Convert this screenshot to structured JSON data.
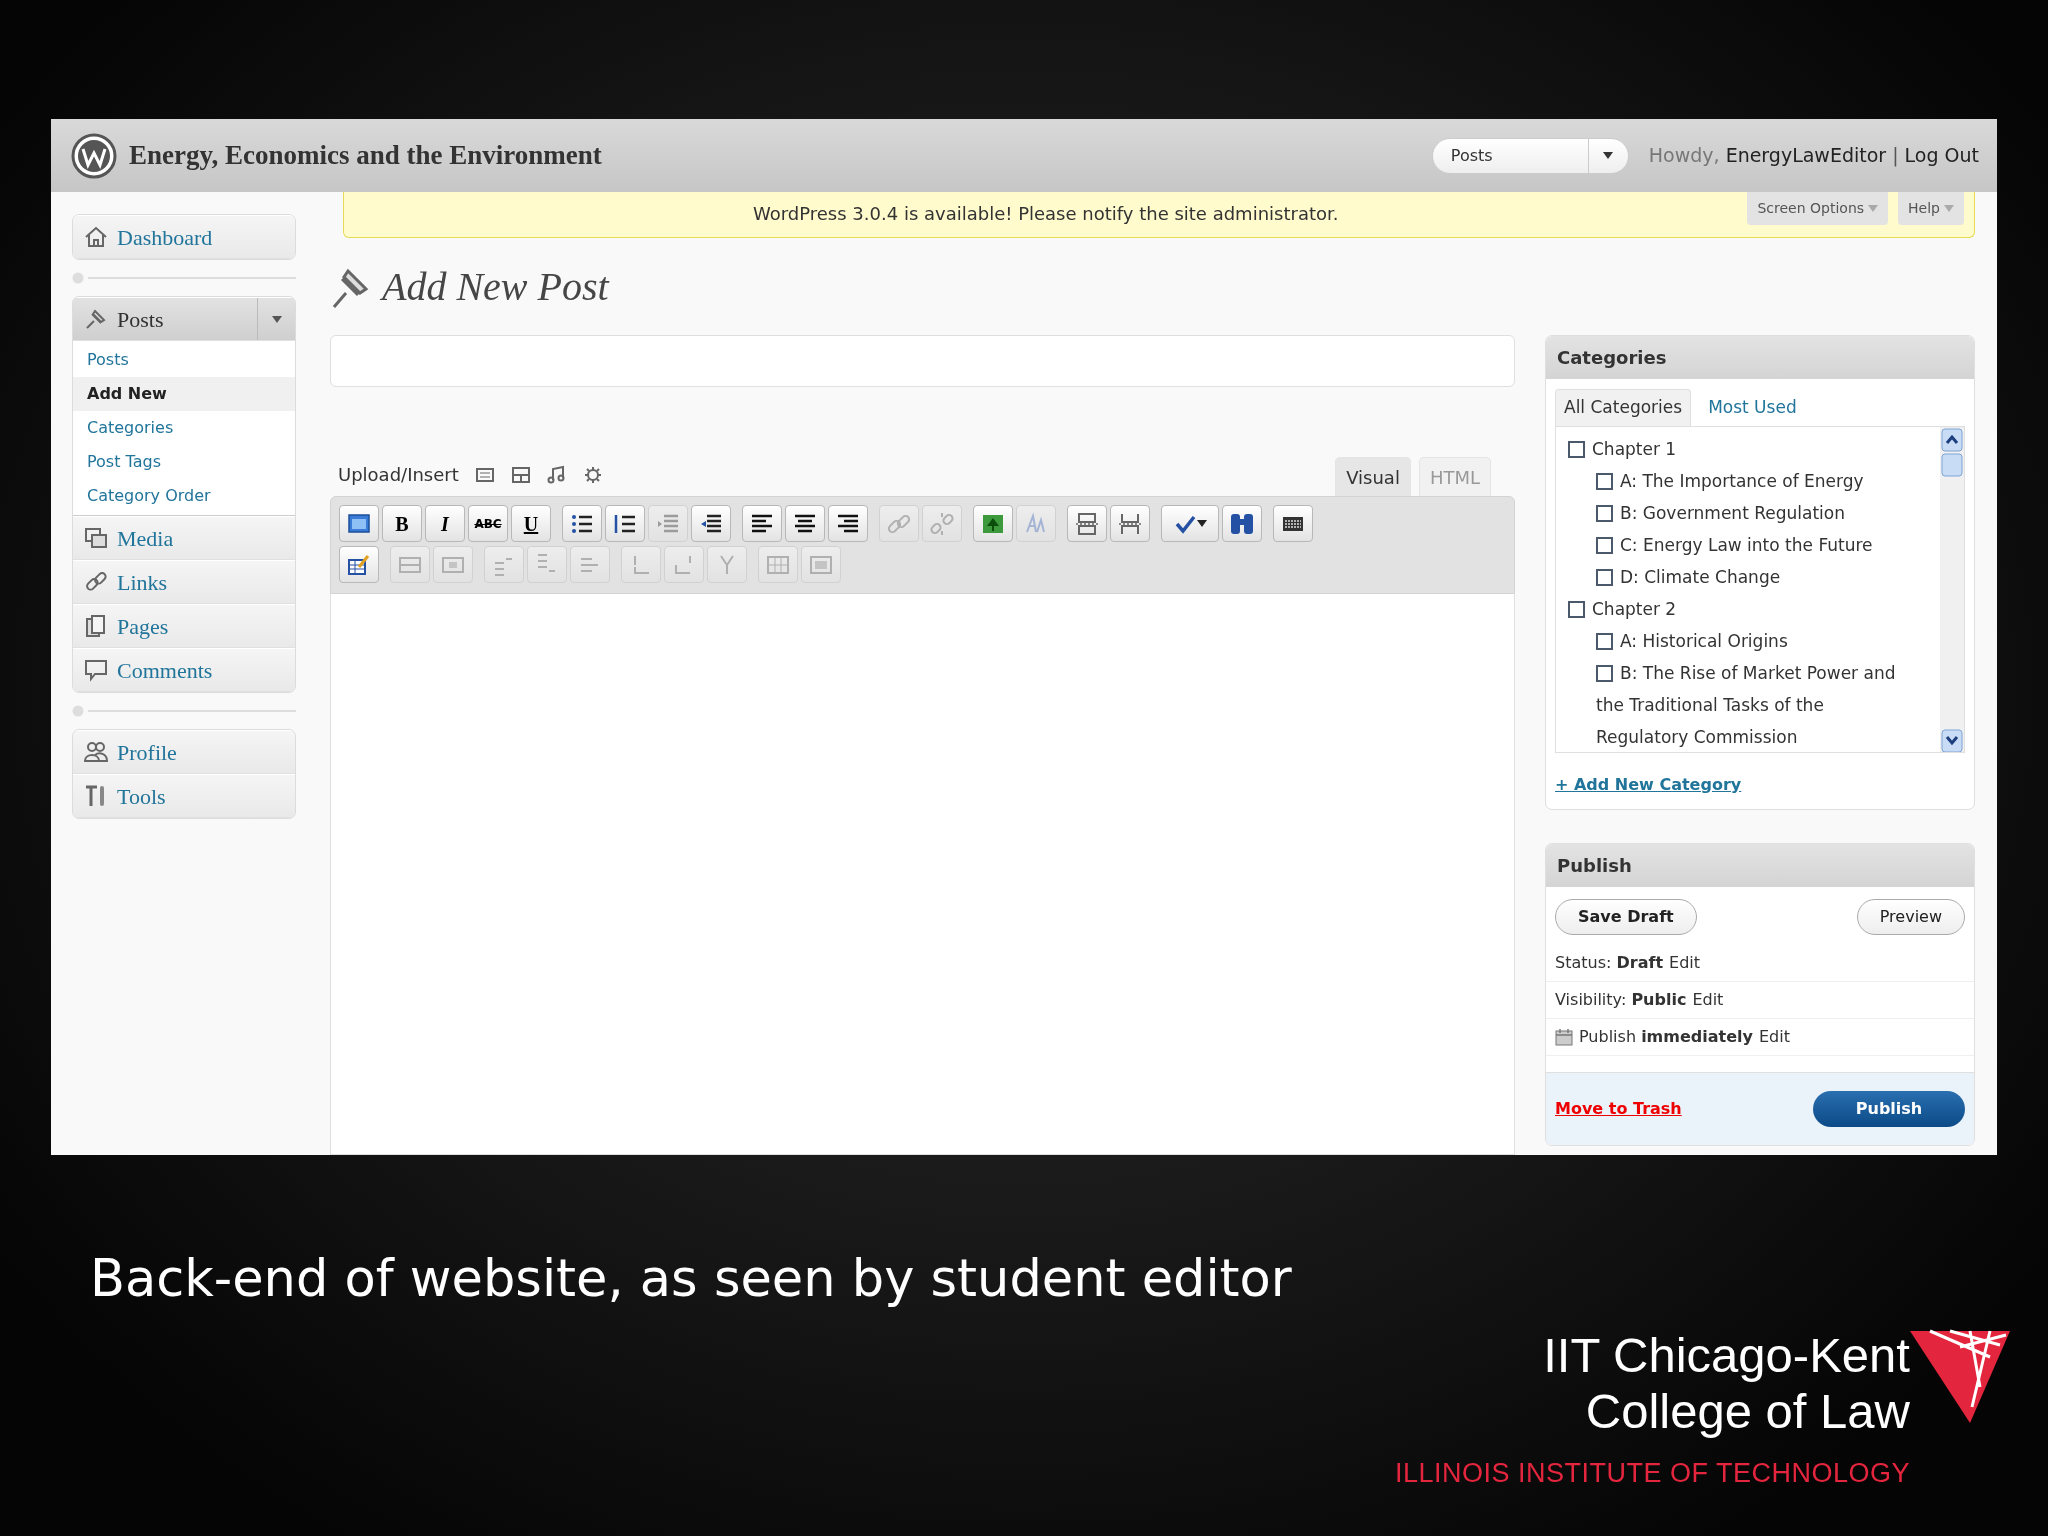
{
  "header": {
    "site_title": "Energy, Economics and the Environment",
    "favorites": "Posts",
    "greeting": "Howdy,",
    "user": "EnergyLawEditor",
    "separator": "|",
    "logout": "Log Out"
  },
  "notice": {
    "link": "WordPress 3.0.4",
    "text": "is available! Please notify the site administrator."
  },
  "screen_tabs": [
    {
      "label": "Screen Options"
    },
    {
      "label": "Help"
    }
  ],
  "sidebar": {
    "groups": [
      {
        "items": [
          {
            "label": "Dashboard",
            "kind": "house",
            "expanded": false
          }
        ]
      },
      {
        "items": [
          {
            "label": "Posts",
            "kind": "pin",
            "expanded": true,
            "children": [
              {
                "label": "Posts",
                "selected": false
              },
              {
                "label": "Add New",
                "selected": true
              },
              {
                "label": "Categories",
                "selected": false
              },
              {
                "label": "Post Tags",
                "selected": false
              },
              {
                "label": "Category Order",
                "selected": false
              }
            ]
          },
          {
            "label": "Media",
            "kind": "media",
            "expanded": false
          },
          {
            "label": "Links",
            "kind": "link",
            "expanded": false
          },
          {
            "label": "Pages",
            "kind": "pages",
            "expanded": false
          },
          {
            "label": "Comments",
            "kind": "comments",
            "expanded": false
          }
        ]
      },
      {
        "items": [
          {
            "label": "Profile",
            "kind": "profile",
            "expanded": false
          },
          {
            "label": "Tools",
            "kind": "tools",
            "expanded": false
          }
        ]
      }
    ]
  },
  "page_title": "Add New Post",
  "upload_label": "Upload/Insert",
  "upload_icons": [
    {
      "kind": "image"
    },
    {
      "kind": "video"
    },
    {
      "kind": "audio"
    },
    {
      "kind": "media"
    }
  ],
  "editor_tabs": [
    {
      "label": "Visual",
      "selected": true
    },
    {
      "label": "HTML",
      "selected": false
    }
  ],
  "toolbar": [
    [
      [
        {
          "kind": "toggle",
          "disabled": false
        },
        {
          "kind": "bold",
          "label": "B",
          "disabled": false
        },
        {
          "kind": "italic",
          "label": "I",
          "disabled": false
        },
        {
          "kind": "strike",
          "label": "ABC",
          "disabled": false
        },
        {
          "kind": "underline",
          "label": "U",
          "disabled": false
        }
      ],
      [
        {
          "kind": "bullets",
          "disabled": false
        },
        {
          "kind": "numbers",
          "disabled": false
        },
        {
          "kind": "outdent",
          "disabled": true
        },
        {
          "kind": "indent",
          "disabled": false
        }
      ],
      [
        {
          "kind": "align-left",
          "disabled": false
        },
        {
          "kind": "align-center",
          "disabled": false
        },
        {
          "kind": "align-right",
          "disabled": false
        }
      ],
      [
        {
          "kind": "link",
          "disabled": true
        },
        {
          "kind": "unlink",
          "disabled": true
        }
      ],
      [
        {
          "kind": "image",
          "disabled": false
        },
        {
          "kind": "style",
          "disabled": true
        }
      ],
      [
        {
          "kind": "break",
          "disabled": false
        },
        {
          "kind": "more",
          "disabled": false
        }
      ],
      [
        {
          "kind": "spell",
          "disabled": false
        },
        {
          "kind": "find",
          "disabled": false
        }
      ],
      [
        {
          "kind": "grid",
          "disabled": false
        }
      ]
    ],
    [
      [
        {
          "kind": "table",
          "disabled": false
        }
      ],
      [
        {
          "kind": "row-props",
          "disabled": true
        },
        {
          "kind": "cell-props",
          "disabled": true
        }
      ],
      [
        {
          "kind": "row-before",
          "disabled": true
        },
        {
          "kind": "row-after",
          "disabled": true
        },
        {
          "kind": "row-delete",
          "disabled": true
        }
      ],
      [
        {
          "kind": "col-before",
          "disabled": true
        },
        {
          "kind": "col-after",
          "disabled": true
        },
        {
          "kind": "col-delete",
          "disabled": true
        }
      ],
      [
        {
          "kind": "split",
          "disabled": true
        },
        {
          "kind": "merge",
          "disabled": true
        }
      ]
    ]
  ],
  "categories": {
    "title": "Categories",
    "tabs": [
      {
        "label": "All Categories",
        "selected": true
      },
      {
        "label": "Most Used",
        "selected": false
      }
    ],
    "items": [
      {
        "label": "Chapter 1",
        "checked": false,
        "children": [
          {
            "label": "A: The Importance of Energy",
            "checked": false
          },
          {
            "label": "B: Government Regulation",
            "checked": false
          },
          {
            "label": "C: Energy Law into the Future",
            "checked": false
          },
          {
            "label": "D: Climate Change",
            "checked": false
          }
        ]
      },
      {
        "label": "Chapter 2",
        "checked": false,
        "children": [
          {
            "label": "A: Historical Origins",
            "checked": false
          },
          {
            "label": "B: The Rise of Market Power and the Traditional Tasks of the Regulatory Commission",
            "checked": false
          }
        ]
      }
    ],
    "add_link": "+ Add New Category"
  },
  "publish": {
    "title": "Publish",
    "buttons": [
      "Save Draft",
      "Preview"
    ],
    "rows": [
      {
        "kind": "plain",
        "text": "Status: **Draft**",
        "link": "Edit"
      },
      {
        "kind": "plain",
        "text": "Visibility: **Public**",
        "link": "Edit"
      },
      {
        "kind": "calendar",
        "text": "Publish **immediately**",
        "link": "Edit"
      }
    ],
    "trash": "Move to Trash",
    "publish": "Publish"
  },
  "caption": "Back-end of website, as seen by student editor",
  "logo": {
    "line1": "IIT Chicago-Kent",
    "line2": "College of Law",
    "line3": "ILLINOIS INSTITUTE OF TECHNOLOGY"
  }
}
